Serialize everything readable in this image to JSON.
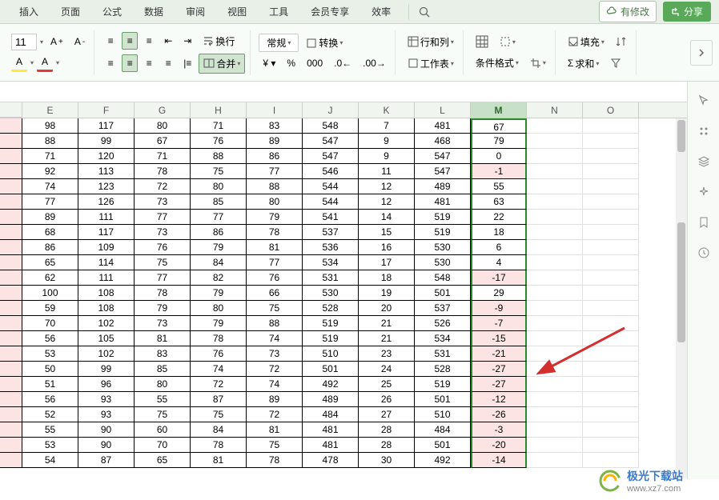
{
  "tabs": [
    "插入",
    "页面",
    "公式",
    "数据",
    "审阅",
    "视图",
    "工具",
    "会员专享",
    "效率"
  ],
  "header": {
    "changes": "有修改",
    "share": "分享"
  },
  "ribbon": {
    "fontsize": "11",
    "format_dd": "常规",
    "convert": "转换",
    "rowcol": "行和列",
    "worksheet": "工作表",
    "condformat": "条件格式",
    "fill": "填充",
    "sum": "求和",
    "merge": "合并",
    "wrap": "换行"
  },
  "columns": [
    "E",
    "F",
    "G",
    "H",
    "I",
    "J",
    "K",
    "L",
    "M",
    "N",
    "O"
  ],
  "selected_col": "M",
  "chart_data": {
    "type": "table",
    "columns": [
      "E",
      "F",
      "G",
      "H",
      "I",
      "J",
      "K",
      "L",
      "M"
    ],
    "rows": [
      [
        98,
        117,
        80,
        71,
        83,
        548,
        7,
        481,
        67
      ],
      [
        88,
        99,
        67,
        76,
        89,
        547,
        9,
        468,
        79
      ],
      [
        71,
        120,
        71,
        88,
        86,
        547,
        9,
        547,
        0
      ],
      [
        92,
        113,
        78,
        75,
        77,
        546,
        11,
        547,
        -1
      ],
      [
        74,
        123,
        72,
        80,
        88,
        544,
        12,
        489,
        55
      ],
      [
        77,
        126,
        73,
        85,
        80,
        544,
        12,
        481,
        63
      ],
      [
        89,
        111,
        77,
        77,
        79,
        541,
        14,
        519,
        22
      ],
      [
        68,
        117,
        73,
        86,
        78,
        537,
        15,
        519,
        18
      ],
      [
        86,
        109,
        76,
        79,
        81,
        536,
        16,
        530,
        6
      ],
      [
        65,
        114,
        75,
        84,
        77,
        534,
        17,
        530,
        4
      ],
      [
        62,
        111,
        77,
        82,
        76,
        531,
        18,
        548,
        -17
      ],
      [
        100,
        108,
        78,
        79,
        66,
        530,
        19,
        501,
        29
      ],
      [
        59,
        108,
        79,
        80,
        75,
        528,
        20,
        537,
        -9
      ],
      [
        70,
        102,
        73,
        79,
        88,
        519,
        21,
        526,
        -7
      ],
      [
        56,
        105,
        81,
        78,
        74,
        519,
        21,
        534,
        -15
      ],
      [
        53,
        102,
        83,
        76,
        73,
        510,
        23,
        531,
        -21
      ],
      [
        50,
        99,
        85,
        74,
        72,
        501,
        24,
        528,
        -27
      ],
      [
        51,
        96,
        80,
        72,
        74,
        492,
        25,
        519,
        -27
      ],
      [
        56,
        93,
        55,
        87,
        89,
        489,
        26,
        501,
        -12
      ],
      [
        52,
        93,
        75,
        75,
        72,
        484,
        27,
        510,
        -26
      ],
      [
        55,
        90,
        60,
        84,
        81,
        481,
        28,
        484,
        -3
      ],
      [
        53,
        90,
        70,
        78,
        75,
        481,
        28,
        501,
        -20
      ],
      [
        54,
        87,
        65,
        81,
        78,
        478,
        30,
        492,
        -14
      ]
    ]
  },
  "watermark": {
    "name": "极光下载站",
    "url": "www.xz7.com"
  }
}
